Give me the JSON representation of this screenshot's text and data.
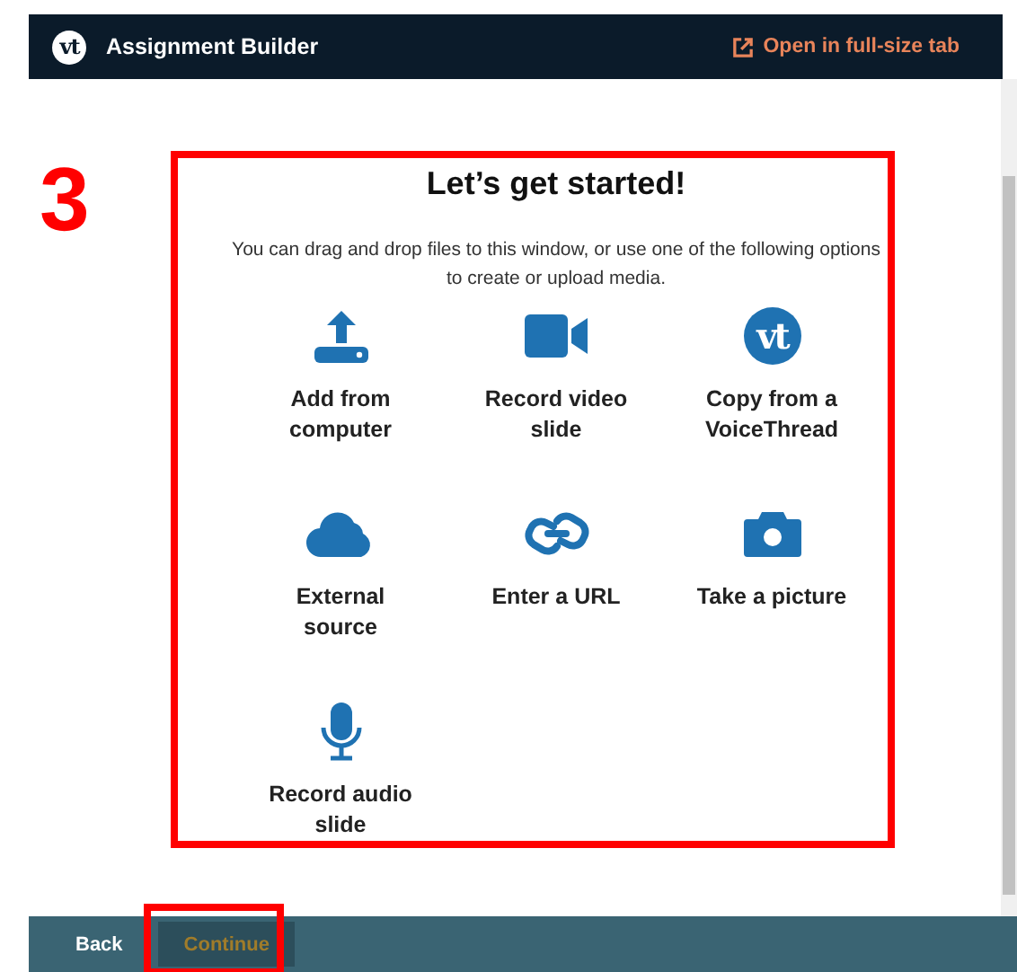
{
  "header": {
    "logo": "vt",
    "title": "Assignment Builder",
    "link": "Open in full-size tab"
  },
  "annotation": {
    "label": "3"
  },
  "panel": {
    "title": "Let’s get started!",
    "description": "You can drag and drop files to this window, or use one of the following options to create or upload media.",
    "options": [
      {
        "kind": "upload",
        "label": "Add from computer"
      },
      {
        "kind": "video",
        "label": "Record video slide"
      },
      {
        "kind": "voicethread",
        "label": "Copy from a VoiceThread",
        "logo": "vt"
      },
      {
        "kind": "cloud",
        "label": "External source"
      },
      {
        "kind": "link",
        "label": "Enter a URL"
      },
      {
        "kind": "camera",
        "label": "Take a picture"
      },
      {
        "kind": "mic",
        "label": "Record audio slide"
      }
    ]
  },
  "footer": {
    "buttons": [
      {
        "label": "Back",
        "disabled": false
      },
      {
        "label": "Continue",
        "disabled": true
      }
    ]
  }
}
